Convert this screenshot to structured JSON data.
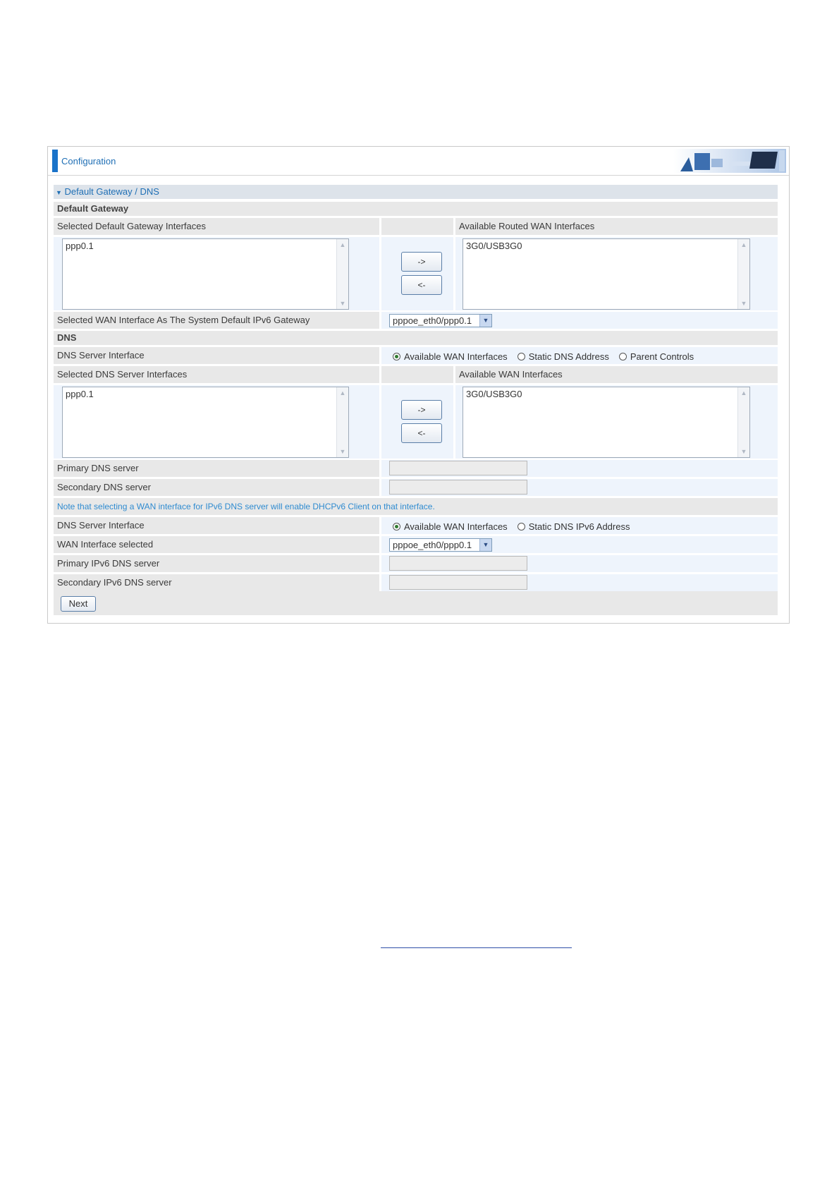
{
  "header": {
    "title": "Configuration"
  },
  "section": {
    "label": "Default Gateway / DNS",
    "expand_icon": "triangle-down-icon"
  },
  "default_gateway": {
    "title": "Default Gateway",
    "selected_label": "Selected Default Gateway Interfaces",
    "available_label": "Available Routed WAN Interfaces",
    "selected_items": [
      "ppp0.1"
    ],
    "available_items": [
      "3G0/USB3G0"
    ],
    "move_right_label": "->",
    "move_left_label": "<-",
    "ipv6_gateway_label": "Selected WAN Interface As The System Default IPv6 Gateway",
    "ipv6_gateway_value": "pppoe_eth0/ppp0.1"
  },
  "dns": {
    "title": "DNS",
    "server_interface_label": "DNS Server Interface",
    "server_interface_options": [
      "Available WAN Interfaces",
      "Static DNS Address",
      "Parent Controls"
    ],
    "server_interface_selected": 0,
    "selected_label": "Selected DNS Server Interfaces",
    "available_label": "Available WAN Interfaces",
    "selected_items": [
      "ppp0.1"
    ],
    "available_items": [
      "3G0/USB3G0"
    ],
    "move_right_label": "->",
    "move_left_label": "<-",
    "primary_label": "Primary DNS server",
    "primary_value": "",
    "secondary_label": "Secondary DNS server",
    "secondary_value": "",
    "note": "Note that selecting a WAN interface for IPv6 DNS server will enable DHCPv6 Client on that interface.",
    "ipv6_server_interface_label": "DNS Server Interface",
    "ipv6_server_interface_options": [
      "Available WAN Interfaces",
      "Static DNS IPv6 Address"
    ],
    "ipv6_server_interface_selected": 0,
    "wan_selected_label": "WAN Interface selected",
    "wan_selected_value": "pppoe_eth0/ppp0.1",
    "primary_ipv6_label": "Primary IPv6 DNS server",
    "primary_ipv6_value": "",
    "secondary_ipv6_label": "Secondary IPv6 DNS server",
    "secondary_ipv6_value": ""
  },
  "footer": {
    "next_label": "Next"
  },
  "colors": {
    "accent": "#1a73c9",
    "title_text": "#1f6fb5",
    "note_text": "#2f8bd0"
  }
}
